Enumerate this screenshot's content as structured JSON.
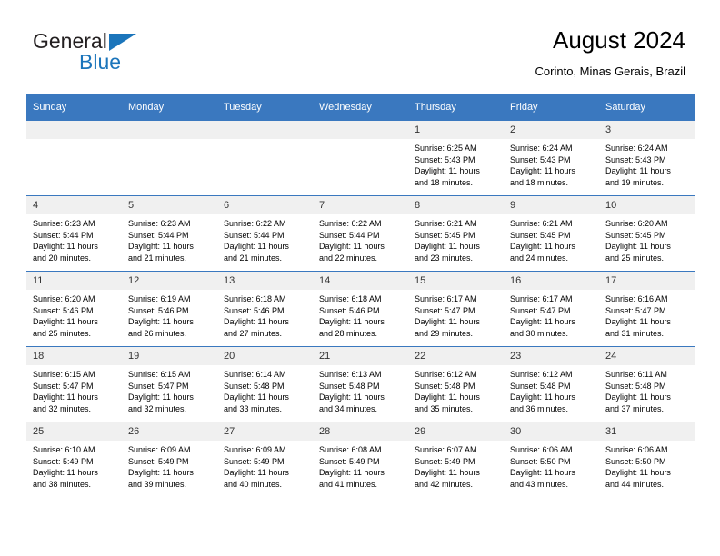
{
  "brand": {
    "name_part1": "General",
    "name_part2": "Blue",
    "flag_icon": "triangle-flag-icon"
  },
  "header": {
    "title": "August 2024",
    "subtitle": "Corinto, Minas Gerais, Brazil"
  },
  "calendar": {
    "accent_color": "#3a78bf",
    "daynum_bg": "#f0f0f0",
    "weekday_headers": [
      "Sunday",
      "Monday",
      "Tuesday",
      "Wednesday",
      "Thursday",
      "Friday",
      "Saturday"
    ],
    "weeks": [
      [
        {
          "day": "",
          "sunrise": "",
          "sunset": "",
          "daylight1": "",
          "daylight2": "",
          "empty": true
        },
        {
          "day": "",
          "sunrise": "",
          "sunset": "",
          "daylight1": "",
          "daylight2": "",
          "empty": true
        },
        {
          "day": "",
          "sunrise": "",
          "sunset": "",
          "daylight1": "",
          "daylight2": "",
          "empty": true
        },
        {
          "day": "",
          "sunrise": "",
          "sunset": "",
          "daylight1": "",
          "daylight2": "",
          "empty": true
        },
        {
          "day": "1",
          "sunrise": "Sunrise: 6:25 AM",
          "sunset": "Sunset: 5:43 PM",
          "daylight1": "Daylight: 11 hours",
          "daylight2": "and 18 minutes."
        },
        {
          "day": "2",
          "sunrise": "Sunrise: 6:24 AM",
          "sunset": "Sunset: 5:43 PM",
          "daylight1": "Daylight: 11 hours",
          "daylight2": "and 18 minutes."
        },
        {
          "day": "3",
          "sunrise": "Sunrise: 6:24 AM",
          "sunset": "Sunset: 5:43 PM",
          "daylight1": "Daylight: 11 hours",
          "daylight2": "and 19 minutes."
        }
      ],
      [
        {
          "day": "4",
          "sunrise": "Sunrise: 6:23 AM",
          "sunset": "Sunset: 5:44 PM",
          "daylight1": "Daylight: 11 hours",
          "daylight2": "and 20 minutes."
        },
        {
          "day": "5",
          "sunrise": "Sunrise: 6:23 AM",
          "sunset": "Sunset: 5:44 PM",
          "daylight1": "Daylight: 11 hours",
          "daylight2": "and 21 minutes."
        },
        {
          "day": "6",
          "sunrise": "Sunrise: 6:22 AM",
          "sunset": "Sunset: 5:44 PM",
          "daylight1": "Daylight: 11 hours",
          "daylight2": "and 21 minutes."
        },
        {
          "day": "7",
          "sunrise": "Sunrise: 6:22 AM",
          "sunset": "Sunset: 5:44 PM",
          "daylight1": "Daylight: 11 hours",
          "daylight2": "and 22 minutes."
        },
        {
          "day": "8",
          "sunrise": "Sunrise: 6:21 AM",
          "sunset": "Sunset: 5:45 PM",
          "daylight1": "Daylight: 11 hours",
          "daylight2": "and 23 minutes."
        },
        {
          "day": "9",
          "sunrise": "Sunrise: 6:21 AM",
          "sunset": "Sunset: 5:45 PM",
          "daylight1": "Daylight: 11 hours",
          "daylight2": "and 24 minutes."
        },
        {
          "day": "10",
          "sunrise": "Sunrise: 6:20 AM",
          "sunset": "Sunset: 5:45 PM",
          "daylight1": "Daylight: 11 hours",
          "daylight2": "and 25 minutes."
        }
      ],
      [
        {
          "day": "11",
          "sunrise": "Sunrise: 6:20 AM",
          "sunset": "Sunset: 5:46 PM",
          "daylight1": "Daylight: 11 hours",
          "daylight2": "and 25 minutes."
        },
        {
          "day": "12",
          "sunrise": "Sunrise: 6:19 AM",
          "sunset": "Sunset: 5:46 PM",
          "daylight1": "Daylight: 11 hours",
          "daylight2": "and 26 minutes."
        },
        {
          "day": "13",
          "sunrise": "Sunrise: 6:18 AM",
          "sunset": "Sunset: 5:46 PM",
          "daylight1": "Daylight: 11 hours",
          "daylight2": "and 27 minutes."
        },
        {
          "day": "14",
          "sunrise": "Sunrise: 6:18 AM",
          "sunset": "Sunset: 5:46 PM",
          "daylight1": "Daylight: 11 hours",
          "daylight2": "and 28 minutes."
        },
        {
          "day": "15",
          "sunrise": "Sunrise: 6:17 AM",
          "sunset": "Sunset: 5:47 PM",
          "daylight1": "Daylight: 11 hours",
          "daylight2": "and 29 minutes."
        },
        {
          "day": "16",
          "sunrise": "Sunrise: 6:17 AM",
          "sunset": "Sunset: 5:47 PM",
          "daylight1": "Daylight: 11 hours",
          "daylight2": "and 30 minutes."
        },
        {
          "day": "17",
          "sunrise": "Sunrise: 6:16 AM",
          "sunset": "Sunset: 5:47 PM",
          "daylight1": "Daylight: 11 hours",
          "daylight2": "and 31 minutes."
        }
      ],
      [
        {
          "day": "18",
          "sunrise": "Sunrise: 6:15 AM",
          "sunset": "Sunset: 5:47 PM",
          "daylight1": "Daylight: 11 hours",
          "daylight2": "and 32 minutes."
        },
        {
          "day": "19",
          "sunrise": "Sunrise: 6:15 AM",
          "sunset": "Sunset: 5:47 PM",
          "daylight1": "Daylight: 11 hours",
          "daylight2": "and 32 minutes."
        },
        {
          "day": "20",
          "sunrise": "Sunrise: 6:14 AM",
          "sunset": "Sunset: 5:48 PM",
          "daylight1": "Daylight: 11 hours",
          "daylight2": "and 33 minutes."
        },
        {
          "day": "21",
          "sunrise": "Sunrise: 6:13 AM",
          "sunset": "Sunset: 5:48 PM",
          "daylight1": "Daylight: 11 hours",
          "daylight2": "and 34 minutes."
        },
        {
          "day": "22",
          "sunrise": "Sunrise: 6:12 AM",
          "sunset": "Sunset: 5:48 PM",
          "daylight1": "Daylight: 11 hours",
          "daylight2": "and 35 minutes."
        },
        {
          "day": "23",
          "sunrise": "Sunrise: 6:12 AM",
          "sunset": "Sunset: 5:48 PM",
          "daylight1": "Daylight: 11 hours",
          "daylight2": "and 36 minutes."
        },
        {
          "day": "24",
          "sunrise": "Sunrise: 6:11 AM",
          "sunset": "Sunset: 5:48 PM",
          "daylight1": "Daylight: 11 hours",
          "daylight2": "and 37 minutes."
        }
      ],
      [
        {
          "day": "25",
          "sunrise": "Sunrise: 6:10 AM",
          "sunset": "Sunset: 5:49 PM",
          "daylight1": "Daylight: 11 hours",
          "daylight2": "and 38 minutes."
        },
        {
          "day": "26",
          "sunrise": "Sunrise: 6:09 AM",
          "sunset": "Sunset: 5:49 PM",
          "daylight1": "Daylight: 11 hours",
          "daylight2": "and 39 minutes."
        },
        {
          "day": "27",
          "sunrise": "Sunrise: 6:09 AM",
          "sunset": "Sunset: 5:49 PM",
          "daylight1": "Daylight: 11 hours",
          "daylight2": "and 40 minutes."
        },
        {
          "day": "28",
          "sunrise": "Sunrise: 6:08 AM",
          "sunset": "Sunset: 5:49 PM",
          "daylight1": "Daylight: 11 hours",
          "daylight2": "and 41 minutes."
        },
        {
          "day": "29",
          "sunrise": "Sunrise: 6:07 AM",
          "sunset": "Sunset: 5:49 PM",
          "daylight1": "Daylight: 11 hours",
          "daylight2": "and 42 minutes."
        },
        {
          "day": "30",
          "sunrise": "Sunrise: 6:06 AM",
          "sunset": "Sunset: 5:50 PM",
          "daylight1": "Daylight: 11 hours",
          "daylight2": "and 43 minutes."
        },
        {
          "day": "31",
          "sunrise": "Sunrise: 6:06 AM",
          "sunset": "Sunset: 5:50 PM",
          "daylight1": "Daylight: 11 hours",
          "daylight2": "and 44 minutes."
        }
      ]
    ]
  }
}
